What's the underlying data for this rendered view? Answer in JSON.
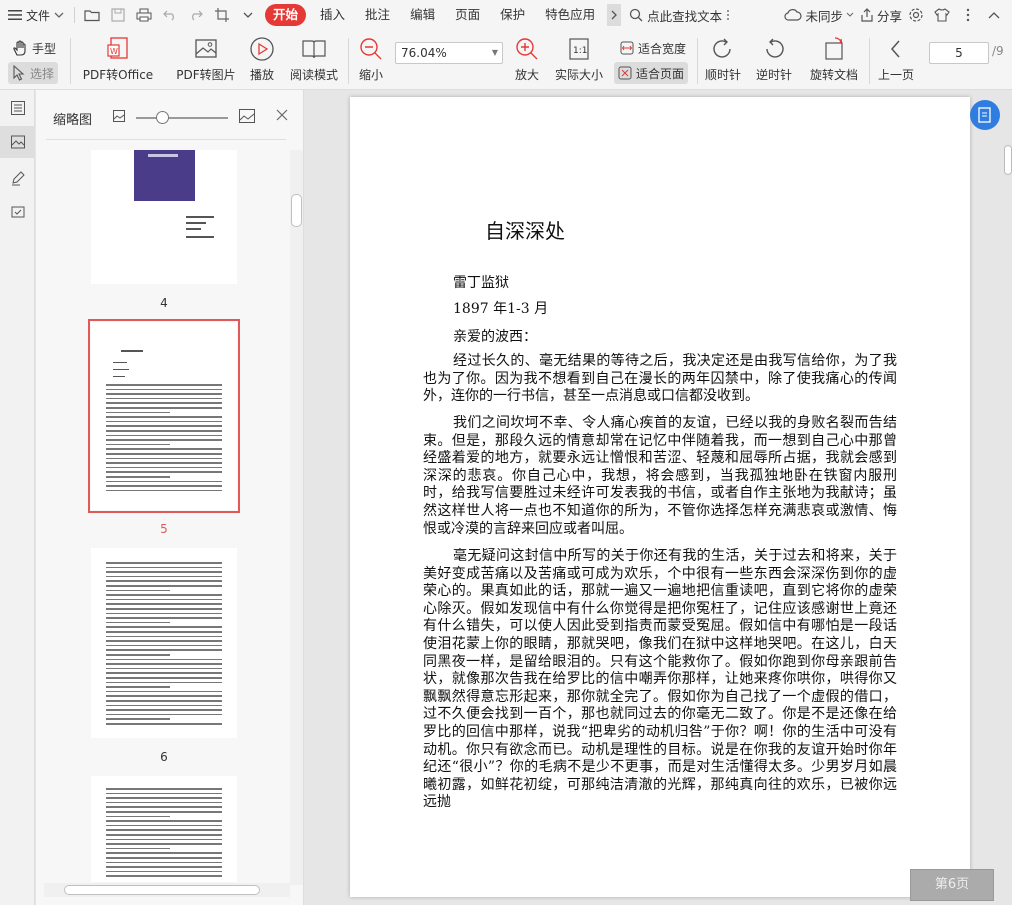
{
  "menubar": {
    "file_label": "文件",
    "tabs": [
      {
        "label": "开始",
        "active": true
      },
      {
        "label": "插入"
      },
      {
        "label": "批注"
      },
      {
        "label": "编辑"
      },
      {
        "label": "页面"
      },
      {
        "label": "保护"
      },
      {
        "label": "特色应用"
      }
    ],
    "search_label": "点此查找文本",
    "sync_label": "未同步",
    "share_label": "分享",
    "accent_color": "#e53935"
  },
  "toolbar": {
    "hand_label": "手型",
    "select_label": "选择",
    "pdf_to_office_label": "PDF转Office",
    "pdf_to_image_label": "PDF转图片",
    "play_label": "播放",
    "read_mode_label": "阅读模式",
    "zoom_out_label": "缩小",
    "zoom_value": "76.04%",
    "zoom_in_label": "放大",
    "actual_size_label": "实际大小",
    "fit_width_label": "适合宽度",
    "fit_page_label": "适合页面",
    "rotate_cw_label": "顺时针",
    "rotate_ccw_label": "逆时针",
    "rotate_doc_label": "旋转文档",
    "prev_page_label": "上一页",
    "current_page": "5",
    "total_pages": "/9"
  },
  "thumbnails": {
    "title": "缩略图",
    "pages": [
      {
        "number": "4",
        "selected": false
      },
      {
        "number": "5",
        "selected": true
      },
      {
        "number": "6",
        "selected": false
      }
    ]
  },
  "document": {
    "title": "自深深处",
    "lines": [
      "雷丁监狱",
      "1897 年1-3 月",
      "亲爱的波西："
    ],
    "paragraphs": [
      "经过长久的、毫无结果的等待之后，我决定还是由我写信给你，为了我也为了你。因为我不想看到自己在漫长的两年囚禁中，除了使我痛心的传闻外，连你的一行书信，甚至一点消息或口信都没收到。",
      "我们之间坎坷不幸、令人痛心疾首的友谊，已经以我的身败名裂而告结束。但是，那段久远的情意却常在记忆中伴随着我，而一想到自己心中那曾经盛着爱的地方，就要永远让憎恨和苦涩、轻蔑和屈辱所占据，我就会感到深深的悲哀。你自己心中，我想，将会感到，当我孤独地卧在铁窗内服刑时，给我写信要胜过未经许可发表我的书信，或者自作主张地为我献诗；虽然这样世人将一点也不知道你的所为，不管你选择怎样充满悲哀或激情、悔恨或冷漠的言辞来回应或者叫屈。",
      "毫无疑问这封信中所写的关于你还有我的生活，关于过去和将来，关于美好变成苦痛以及苦痛或可成为欢乐，个中很有一些东西会深深伤到你的虚荣心的。果真如此的话，那就一遍又一遍地把信重读吧，直到它将你的虚荣心除灭。假如发现信中有什么你觉得是把你冤枉了，记住应该感谢世上竟还有什么错失，可以使人因此受到指责而蒙受冤屈。假如信中有哪怕是一段话使泪花蒙上你的眼睛，那就哭吧，像我们在狱中这样地哭吧。在这儿，白天同黑夜一样，是留给眼泪的。只有这个能救你了。假如你跑到你母亲跟前告状，就像那次告我在给罗比的信中嘲弄你那样，让她来疼你哄你，哄得你又飘飘然得意忘形起来，那你就全完了。假如你为自己找了一个虚假的借口，过不久便会找到一百个，那也就同过去的你毫无二致了。你是不是还像在给罗比的回信中那样，说我“把卑劣的动机归咎”于你？啊！你的生活中可没有动机。你只有欲念而已。动机是理性的目标。说是在你我的友谊开始时你年纪还“很小”？你的毛病不是少不更事，而是对生活懂得太多。少男岁月如晨曦初露，如鲜花初绽，可那纯洁清澈的光辉，那纯真向往的欢乐，已被你远远抛"
    ],
    "page_badge": "第6页"
  }
}
